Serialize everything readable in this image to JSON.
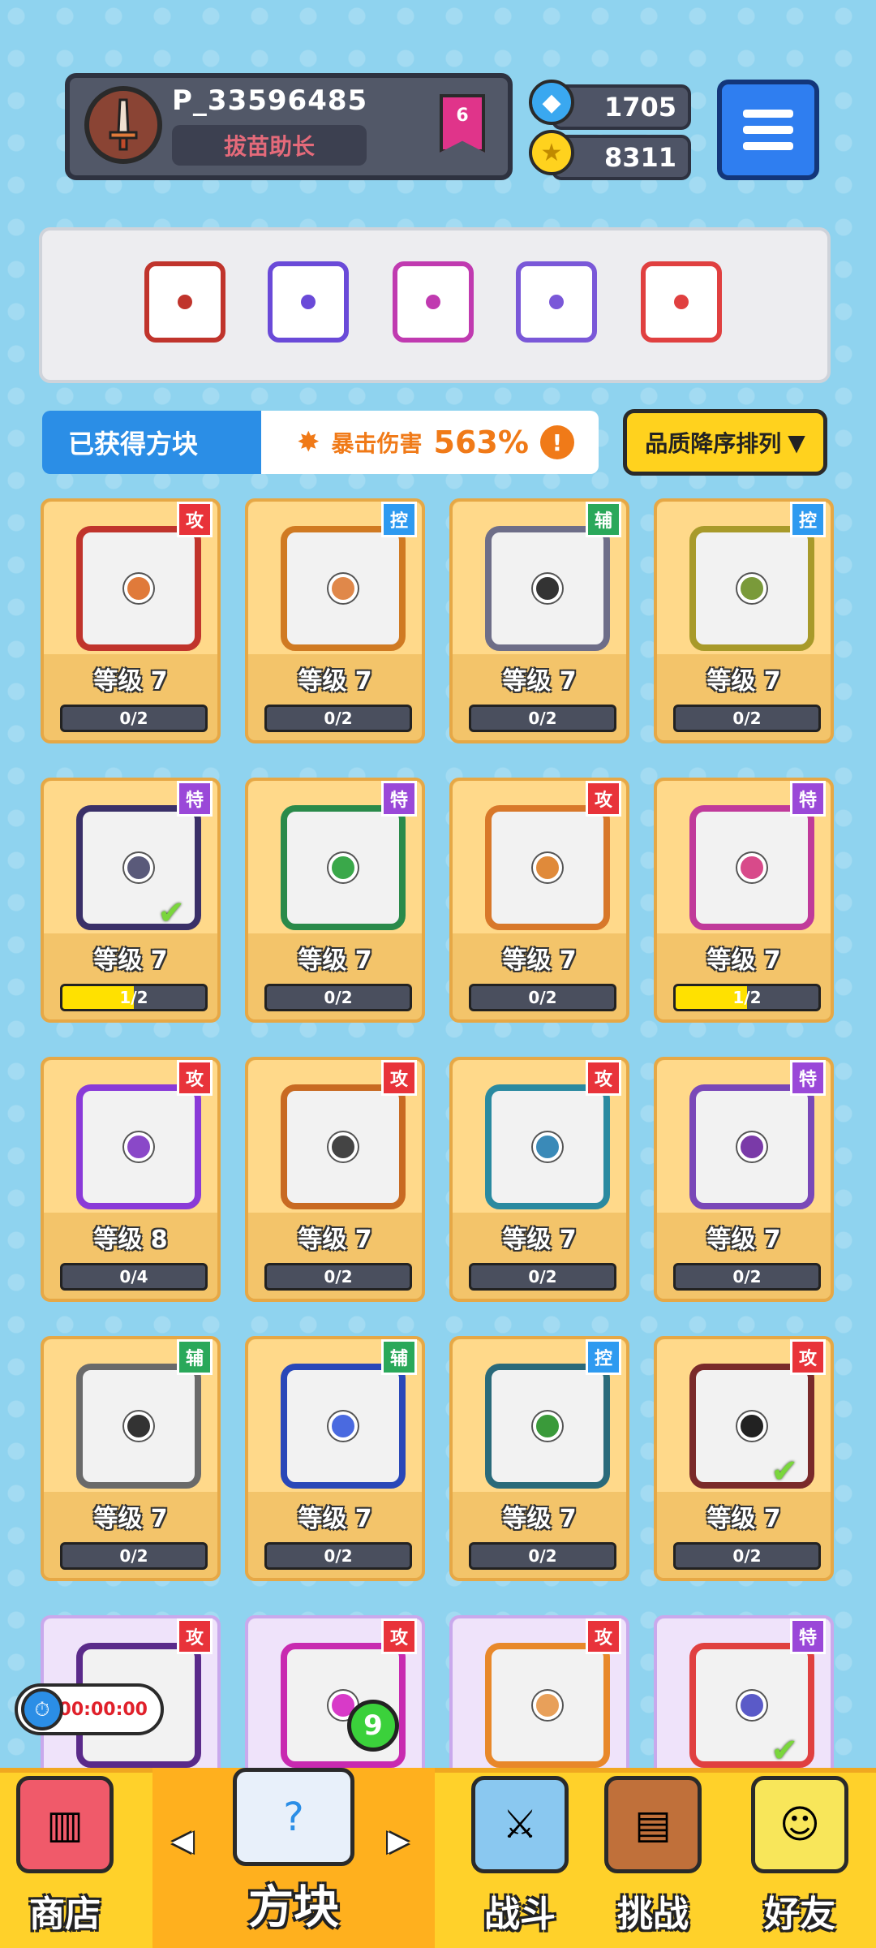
{
  "player": {
    "name": "P_33596485",
    "title": "拔苗助长",
    "rank": "6"
  },
  "currency": {
    "gems": "1705",
    "coins": "8311"
  },
  "equipped": [
    {
      "icon": "saw-block-icon",
      "color": "#c0342c"
    },
    {
      "icon": "ring-block-icon",
      "color": "#6a4ad8"
    },
    {
      "icon": "arrow-block-icon",
      "color": "#c03ab0"
    },
    {
      "icon": "crack-block-icon",
      "color": "#7a58d8"
    },
    {
      "icon": "rainbow-block-icon",
      "color": "#e04040"
    }
  ],
  "section": {
    "owned_label": "已获得方块",
    "crit_label": "暴击伤害",
    "crit_value": "563%",
    "info": "!",
    "sort_label": "品质降序排列",
    "sort_arrow": "▼"
  },
  "cards": [
    {
      "tag": "攻",
      "tag_color": "#e8333a",
      "frame": "#c0342c",
      "dot": "#e07a3a",
      "level": "等级 7",
      "progress": "0/2",
      "fill": 0,
      "checked": false
    },
    {
      "tag": "控",
      "tag_color": "#2e9af0",
      "frame": "#d07a22",
      "dot": "#e0884a",
      "level": "等级 7",
      "progress": "0/2",
      "fill": 0,
      "checked": false
    },
    {
      "tag": "辅",
      "tag_color": "#2aa85a",
      "frame": "#6e6e88",
      "dot": "#333333",
      "level": "等级 7",
      "progress": "0/2",
      "fill": 0,
      "checked": false
    },
    {
      "tag": "控",
      "tag_color": "#2e9af0",
      "frame": "#a89a2a",
      "dot": "#7a9a3a",
      "level": "等级 7",
      "progress": "0/2",
      "fill": 0,
      "checked": false
    },
    {
      "tag": "特",
      "tag_color": "#9a48d8",
      "frame": "#3a3068",
      "dot": "#5a5a7a",
      "level": "等级 7",
      "progress": "1/2",
      "fill": 0.5,
      "checked": true
    },
    {
      "tag": "特",
      "tag_color": "#9a48d8",
      "frame": "#2a8a4a",
      "dot": "#3aa84a",
      "level": "等级 7",
      "progress": "0/2",
      "fill": 0,
      "checked": false
    },
    {
      "tag": "攻",
      "tag_color": "#e8333a",
      "frame": "#d8782a",
      "dot": "#e08a3a",
      "level": "等级 7",
      "progress": "0/2",
      "fill": 0,
      "checked": false
    },
    {
      "tag": "特",
      "tag_color": "#9a48d8",
      "frame": "#c03a9a",
      "dot": "#d84a8a",
      "level": "等级 7",
      "progress": "1/2",
      "fill": 0.5,
      "checked": false
    },
    {
      "tag": "攻",
      "tag_color": "#e8333a",
      "frame": "#8a3ad8",
      "dot": "#8a48c8",
      "level": "等级 8",
      "progress": "0/4",
      "fill": 0,
      "checked": false
    },
    {
      "tag": "攻",
      "tag_color": "#e8333a",
      "frame": "#c86a22",
      "dot": "#444444",
      "level": "等级 7",
      "progress": "0/2",
      "fill": 0,
      "checked": false
    },
    {
      "tag": "攻",
      "tag_color": "#e8333a",
      "frame": "#2a8aa0",
      "dot": "#3a8ab8",
      "level": "等级 7",
      "progress": "0/2",
      "fill": 0,
      "checked": false
    },
    {
      "tag": "特",
      "tag_color": "#9a48d8",
      "frame": "#7a48b8",
      "dot": "#7a3aa8",
      "level": "等级 7",
      "progress": "0/2",
      "fill": 0,
      "checked": false
    },
    {
      "tag": "辅",
      "tag_color": "#2aa85a",
      "frame": "#6a6a6a",
      "dot": "#333333",
      "level": "等级 7",
      "progress": "0/2",
      "fill": 0,
      "checked": false
    },
    {
      "tag": "辅",
      "tag_color": "#2aa85a",
      "frame": "#2a48b8",
      "dot": "#4a6ae0",
      "level": "等级 7",
      "progress": "0/2",
      "fill": 0,
      "checked": false
    },
    {
      "tag": "控",
      "tag_color": "#2e9af0",
      "frame": "#2a6a7a",
      "dot": "#3a9a3a",
      "level": "等级 7",
      "progress": "0/2",
      "fill": 0,
      "checked": false
    },
    {
      "tag": "攻",
      "tag_color": "#e8333a",
      "frame": "#7a2a2a",
      "dot": "#222222",
      "level": "等级 7",
      "progress": "0/2",
      "fill": 0,
      "checked": true
    },
    {
      "tag": "攻",
      "tag_color": "#e8333a",
      "frame": "#5a2a8a",
      "dot": "#c8a8e8",
      "checked": false
    },
    {
      "tag": "攻",
      "tag_color": "#e8333a",
      "frame": "#c82ab0",
      "dot": "#d83ac8",
      "checked": false
    },
    {
      "tag": "攻",
      "tag_color": "#e8333a",
      "frame": "#e8882a",
      "dot": "#e8a05a",
      "checked": false
    },
    {
      "tag": "特",
      "tag_color": "#9a48d8",
      "frame": "#e04040",
      "dot": "#5a5ac8",
      "checked": true
    }
  ],
  "timer": "00:00:00",
  "nav": {
    "shop": "商店",
    "blocks": "方块",
    "battle": "战斗",
    "challenge": "挑战",
    "friends": "好友",
    "block_badge": "9",
    "left_arrow": "◀",
    "right_arrow": "▶"
  }
}
